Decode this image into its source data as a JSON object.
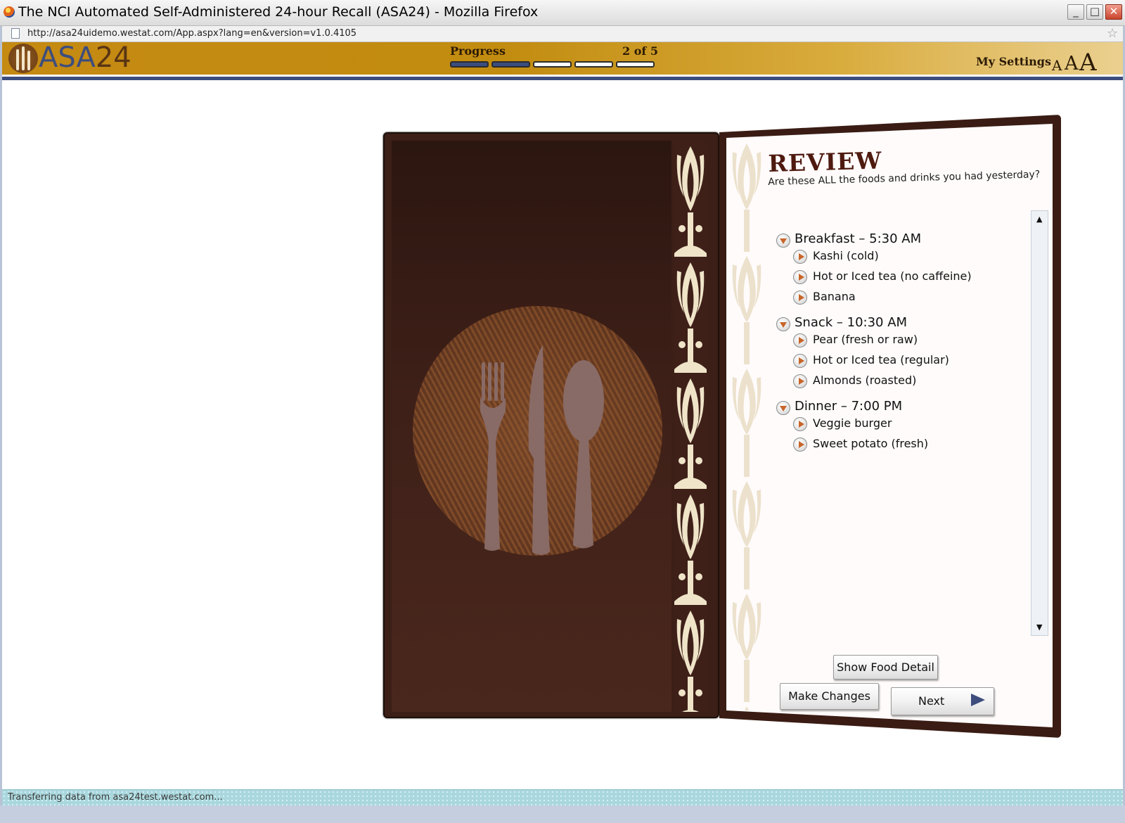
{
  "window": {
    "title": "The NCI Automated Self-Administered 24-hour Recall (ASA24) - Mozilla Firefox",
    "url": "http://asa24uidemo.westat.com/App.aspx?lang=en&version=v1.0.4105",
    "minimize_label": "_",
    "maximize_label": "□",
    "close_label": "✕",
    "bookmark_icon": "☆"
  },
  "header": {
    "logo_part1": "ASA",
    "logo_part2": "24",
    "progress_label": "Progress",
    "progress_count": "2 of 5",
    "progress_completed": 2,
    "progress_total": 5,
    "settings_label": "My Settings",
    "font_small": "A",
    "font_medium": "A",
    "font_large": "A",
    "colors": {
      "brand_gold": "#c48a12",
      "brand_blue": "#3b4c7e",
      "menu_brown": "#3c1f17"
    }
  },
  "review": {
    "title": "REVIEW",
    "question": "Are these ALL the foods and drinks you had yesterday?",
    "meals": [
      {
        "label": "Breakfast – 5:30 AM",
        "foods": [
          "Kashi (cold)",
          "Hot or Iced tea (no caffeine)",
          "Banana"
        ]
      },
      {
        "label": "Snack – 10:30 AM",
        "foods": [
          "Pear (fresh or raw)",
          "Hot or Iced tea (regular)",
          "Almonds (roasted)"
        ]
      },
      {
        "label": "Dinner – 7:00 PM",
        "foods": [
          "Veggie burger",
          "Sweet potato (fresh)"
        ]
      }
    ],
    "scroll_up": "▲",
    "scroll_down": "▼",
    "show_detail_button": "Show Food Detail",
    "make_changes_button": "Make Changes",
    "next_button": "Next"
  },
  "status": {
    "text": "Transferring data from asa24test.westat.com..."
  }
}
